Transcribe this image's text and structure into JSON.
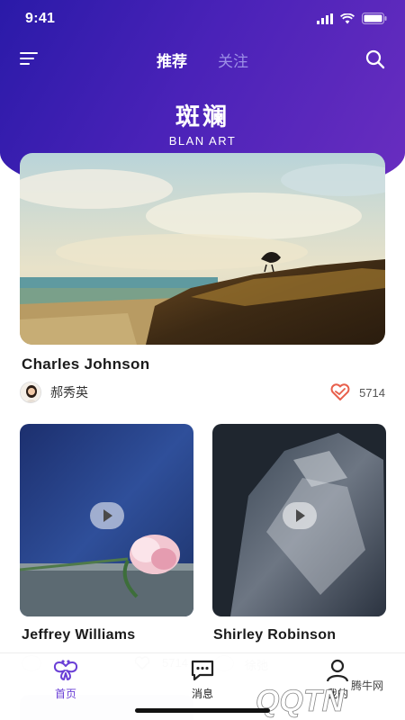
{
  "status_bar": {
    "time": "9:41"
  },
  "nav": {
    "tabs": [
      {
        "label": "推荐",
        "active": true
      },
      {
        "label": "关注",
        "active": false
      }
    ]
  },
  "brand": {
    "title": "斑斓",
    "subtitle": "BLAN ART"
  },
  "featured": {
    "title": "Charles Johnson",
    "author": "郝秀英",
    "likes": "5714"
  },
  "cards": [
    {
      "title": "Jeffrey Williams",
      "type": "video",
      "author": "刘",
      "likes": "5714"
    },
    {
      "title": "Shirley Robinson",
      "type": "video",
      "author": "徐弛"
    }
  ],
  "tabbar": {
    "items": [
      {
        "label": "首页",
        "icon": "butterfly-icon",
        "active": true
      },
      {
        "label": "消息",
        "icon": "message-icon",
        "active": false
      },
      {
        "label": "我的",
        "icon": "person-icon",
        "active": false
      }
    ]
  },
  "watermark": {
    "text": "QQTN",
    "sub": "腾牛网"
  },
  "colors": {
    "accent": "#6a3fd6",
    "hero_start": "#2a1aa8",
    "hero_end": "#6a2ec0",
    "like": "#e8604c"
  }
}
